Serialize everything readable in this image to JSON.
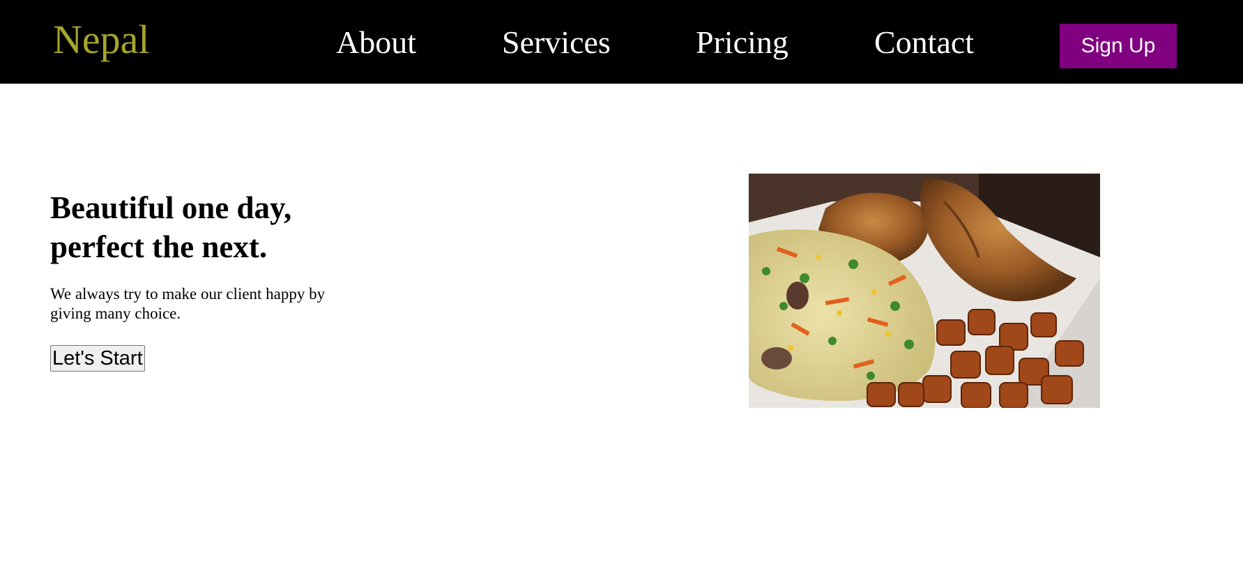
{
  "header": {
    "brand": "Nepal",
    "nav": [
      "About",
      "Services",
      "Pricing",
      "Contact"
    ],
    "signup_label": "Sign Up"
  },
  "hero": {
    "title_line1": "Beautiful one day,",
    "title_line2": "perfect the next.",
    "subtitle": "We always try to make our client happy by giving many choice.",
    "cta_label": "Let's Start"
  },
  "image": {
    "description_icon": "food-plate-image"
  },
  "colors": {
    "navbar_bg": "#000000",
    "brand": "#a6a62c",
    "nav_link": "#ffffff",
    "signup_bg": "#800080",
    "body_bg": "#ffffff"
  }
}
